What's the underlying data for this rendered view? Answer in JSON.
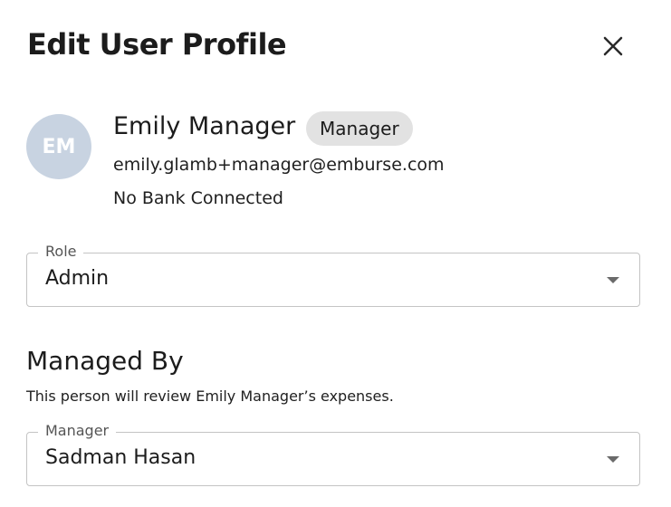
{
  "dialog": {
    "title": "Edit User Profile",
    "close_icon": "close-icon"
  },
  "user": {
    "initials": "EM",
    "name": "Emily Manager",
    "badge": "Manager",
    "email": "emily.glamb+manager@emburse.com",
    "bank_status": "No Bank Connected",
    "avatar_color": "#c8d3e1"
  },
  "role_field": {
    "label": "Role",
    "value": "Admin"
  },
  "managed_by": {
    "title": "Managed By",
    "description": "This person will review Emily Manager’s expenses."
  },
  "manager_field": {
    "label": "Manager",
    "value": "Sadman Hasan"
  }
}
